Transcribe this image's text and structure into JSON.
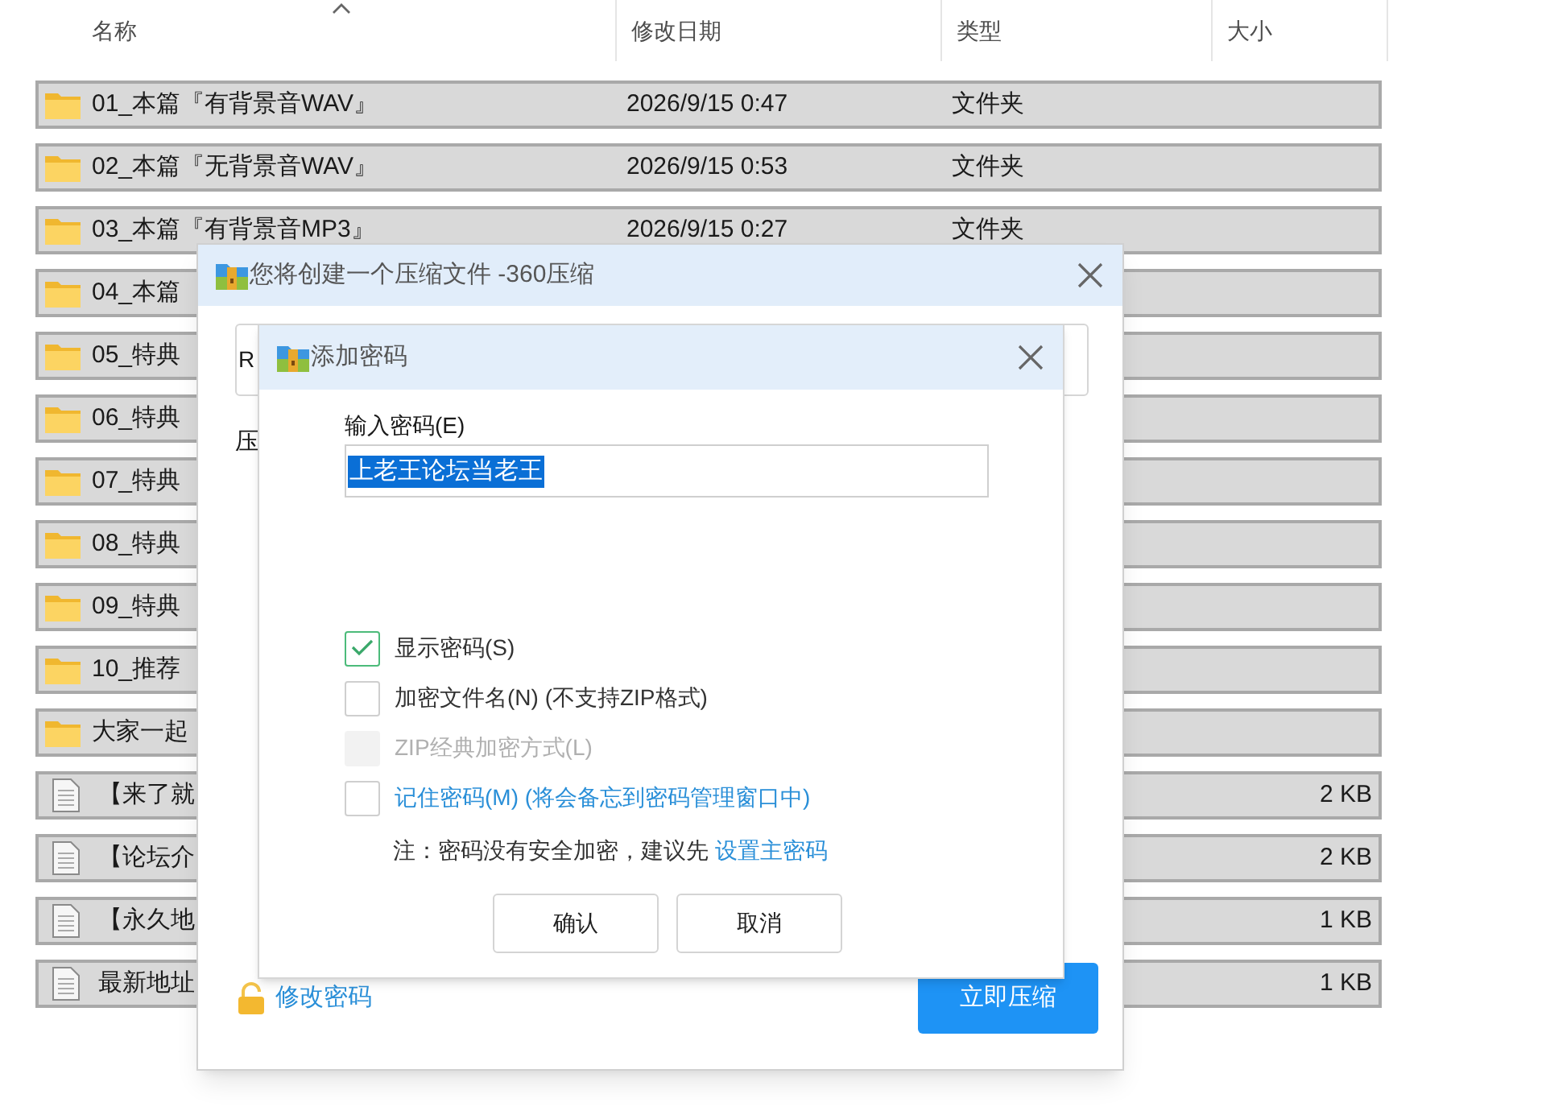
{
  "file_list": {
    "columns": [
      {
        "label": "名称",
        "sorted": true
      },
      {
        "label": "修改日期",
        "sorted": false
      },
      {
        "label": "类型",
        "sorted": false
      },
      {
        "label": "大小",
        "sorted": false
      }
    ],
    "rows": [
      {
        "kind": "folder",
        "name": "01_本篇『有背景音WAV』",
        "date": "2026/9/15 0:47",
        "type": "文件夹"
      },
      {
        "kind": "folder",
        "name": "02_本篇『无背景音WAV』",
        "date": "2026/9/15 0:53",
        "type": "文件夹"
      },
      {
        "kind": "folder",
        "name": "03_本篇『有背景音MP3』",
        "date": "2026/9/15 0:27",
        "type": "文件夹"
      },
      {
        "kind": "folder",
        "name": "04_本篇"
      },
      {
        "kind": "folder",
        "name": "05_特典"
      },
      {
        "kind": "folder",
        "name": "06_特典"
      },
      {
        "kind": "folder",
        "name": "07_特典"
      },
      {
        "kind": "folder",
        "name": "08_特典"
      },
      {
        "kind": "folder",
        "name": "09_特典"
      },
      {
        "kind": "folder",
        "name": "10_推荐"
      },
      {
        "kind": "folder",
        "name": "大家一起"
      },
      {
        "kind": "file",
        "name": "【来了就",
        "size": "2 KB"
      },
      {
        "kind": "file",
        "name": "【论坛介",
        "size": "2 KB"
      },
      {
        "kind": "file",
        "name": "【永久地",
        "size": "1 KB"
      },
      {
        "kind": "file",
        "name": "最新地址",
        "size": "1 KB"
      }
    ]
  },
  "compress_dialog": {
    "title": "您将创建一个压缩文件 -360压缩",
    "field_text": "R",
    "label": "压",
    "change_password_link": "修改密码",
    "compress_button": "立即压缩"
  },
  "password_dialog": {
    "title": "添加密码",
    "field_label": "输入密码(E)",
    "password": "上老王论坛当老王",
    "text_selected": true,
    "options": [
      {
        "kind": "plain",
        "label": "显示密码(S)",
        "checked": true,
        "disabled": false
      },
      {
        "kind": "plain",
        "label": "加密文件名(N) (不支持ZIP格式)",
        "checked": false,
        "disabled": false
      },
      {
        "kind": "plain",
        "label": "ZIP经典加密方式(L)",
        "checked": false,
        "disabled": true
      },
      {
        "kind": "link",
        "label": "记住密码(M) (将会备忘到密码管理窗口中)",
        "checked": false,
        "disabled": false
      }
    ],
    "note": "注：密码没有安全加密，建议先",
    "note_link": "设置主密码",
    "buttons": [
      "确认",
      "取消"
    ]
  }
}
